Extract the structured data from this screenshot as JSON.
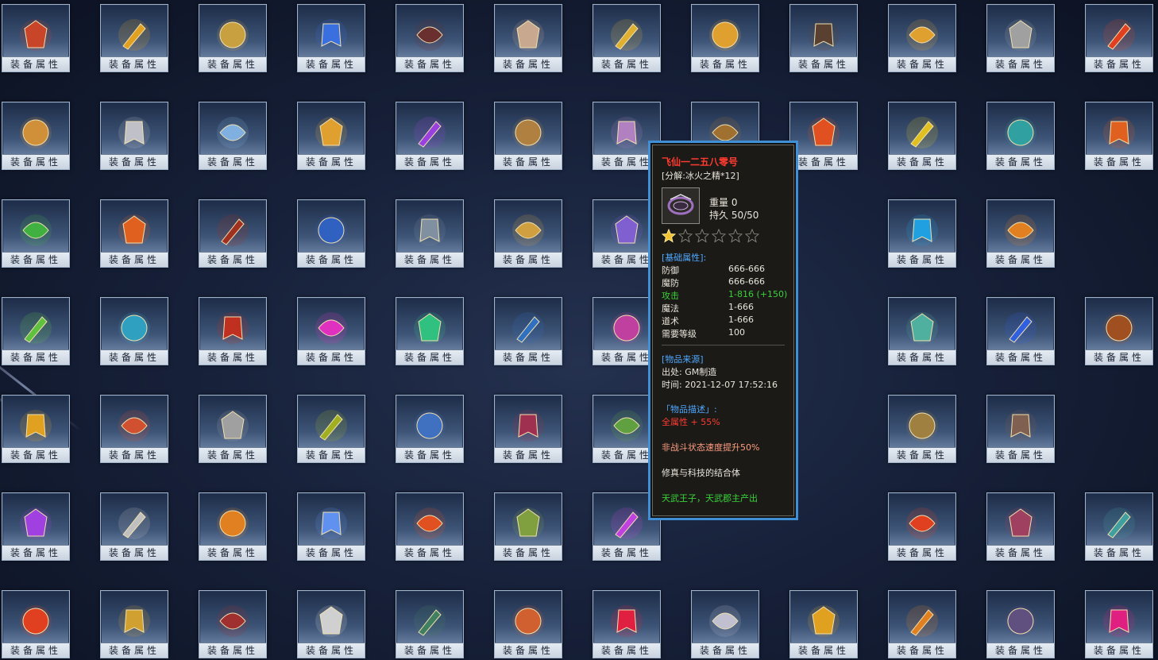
{
  "slot_label": "装备属性",
  "items": [
    {
      "icon": "demon-portrait-icon",
      "color": "#c8452a"
    },
    {
      "icon": "golden-sigil-icon",
      "color": "#e0a020"
    },
    {
      "icon": "golden-warrior-icon",
      "color": "#c9a040"
    },
    {
      "icon": "blue-scroll-icon",
      "color": "#3a6fe0"
    },
    {
      "icon": "dark-gauntlet-icon",
      "color": "#6a3030"
    },
    {
      "icon": "skull-icon",
      "color": "#c9a890"
    },
    {
      "icon": "golden-helmet-icon",
      "color": "#e0b030"
    },
    {
      "icon": "golden-claw-icon",
      "color": "#e0a030"
    },
    {
      "icon": "bracer-icon",
      "color": "#5a4030"
    },
    {
      "icon": "golden-chain-icon",
      "color": "#e0a030"
    },
    {
      "icon": "silver-ring-icon",
      "color": "#a0a0a0"
    },
    {
      "icon": "fire-sword-icon",
      "color": "#e04020"
    },
    {
      "icon": "golden-warrior-icon",
      "color": "#d0903a"
    },
    {
      "icon": "silver-bracelet-icon",
      "color": "#c0c0c8"
    },
    {
      "icon": "ice-bow-icon",
      "color": "#7fb0e0"
    },
    {
      "icon": "golden-warrior-icon",
      "color": "#e0a030"
    },
    {
      "icon": "purple-scroll-icon",
      "color": "#9a40e0"
    },
    {
      "icon": "rune-stone-icon",
      "color": "#b08040"
    },
    {
      "icon": "dark-necklace-icon",
      "color": "#b080c0"
    },
    {
      "icon": "horned-helmet-icon",
      "color": "#a07030"
    },
    {
      "icon": "flame-dagger-icon",
      "color": "#e05020"
    },
    {
      "icon": "yellow-scroll-icon",
      "color": "#e0c020"
    },
    {
      "icon": "jade-ring-icon",
      "color": "#30a0a0"
    },
    {
      "icon": "phoenix-feather-icon",
      "color": "#e06020"
    },
    {
      "icon": "gourd-icon",
      "color": "#40b040"
    },
    {
      "icon": "orange-scroll-icon",
      "color": "#e06020"
    },
    {
      "icon": "red-boots-icon",
      "color": "#a03020"
    },
    {
      "icon": "dragon-armor-icon",
      "color": "#3060c0"
    },
    {
      "icon": "dragon-palace-icon",
      "color": "#8090a0"
    },
    {
      "icon": "golden-egg-icon",
      "color": "#d0a040"
    },
    {
      "icon": "purple-wings-icon",
      "color": "#8060d0"
    },
    {
      "icon": "red-cube-icon",
      "color": "#d04020"
    },
    {
      "icon": "blue-sword-icon",
      "color": "#3080e0"
    },
    {
      "icon": "cyan-scroll-icon",
      "color": "#20a0e0"
    },
    {
      "icon": "golden-sword-icon",
      "color": "#e08020"
    },
    {
      "icon": "none",
      "color": "#000000"
    },
    {
      "icon": "jade-treasure-icon",
      "color": "#60c040"
    },
    {
      "icon": "blue-wings-icon",
      "color": "#30a0c0"
    },
    {
      "icon": "fire-mask-icon",
      "color": "#c03020"
    },
    {
      "icon": "pink-scroll-icon",
      "color": "#e030c0"
    },
    {
      "icon": "jade-halo-icon",
      "color": "#30c080"
    },
    {
      "icon": "earth-orb-icon",
      "color": "#3070c0"
    },
    {
      "icon": "crystal-ball-icon",
      "color": "#c040a0"
    },
    {
      "icon": "none",
      "color": "#000000"
    },
    {
      "icon": "fire-crown-icon",
      "color": "#e06020"
    },
    {
      "icon": "jade-staff-icon",
      "color": "#50b0a0"
    },
    {
      "icon": "blue-shield-icon",
      "color": "#3060e0"
    },
    {
      "icon": "prayer-beads-icon",
      "color": "#a05020"
    },
    {
      "icon": "golden-medallion-icon",
      "color": "#e0a020"
    },
    {
      "icon": "fire-gauntlet-icon",
      "color": "#d05030"
    },
    {
      "icon": "silver-claw-icon",
      "color": "#a0a0a0"
    },
    {
      "icon": "dragon-orb-icon",
      "color": "#a0b020"
    },
    {
      "icon": "blue-mask-icon",
      "color": "#4070c0"
    },
    {
      "icon": "spellbook-icon",
      "color": "#a03050"
    },
    {
      "icon": "leaf-ring-icon",
      "color": "#60a040"
    },
    {
      "icon": "red-dagger-icon",
      "color": "#c02030"
    },
    {
      "icon": "red-scroll-icon",
      "color": "#e02020"
    },
    {
      "icon": "dark-ring-icon",
      "color": "#a08040"
    },
    {
      "icon": "dark-blade-icon",
      "color": "#806050"
    },
    {
      "icon": "none",
      "color": "#000000"
    },
    {
      "icon": "purple-spear-icon",
      "color": "#a040e0"
    },
    {
      "icon": "bone-claw-icon",
      "color": "#c0c0c0"
    },
    {
      "icon": "fire-wand-icon",
      "color": "#e08020"
    },
    {
      "icon": "blue-lotus-icon",
      "color": "#6090f0"
    },
    {
      "icon": "fire-wing-icon",
      "color": "#e05020"
    },
    {
      "icon": "jade-beast-icon",
      "color": "#80a040"
    },
    {
      "icon": "magic-circle-icon",
      "color": "#c040e0"
    },
    {
      "icon": "none",
      "color": "#000000"
    },
    {
      "icon": "ruby-ring-icon",
      "color": "#d0a030"
    },
    {
      "icon": "fire-armor-icon",
      "color": "#e04020"
    },
    {
      "icon": "demon-claw-icon",
      "color": "#a04060"
    },
    {
      "icon": "crystal-armor-icon",
      "color": "#40a0a0"
    },
    {
      "icon": "fire-orb-icon",
      "color": "#e04020"
    },
    {
      "icon": "black-gold-icon",
      "color": "#d0a030"
    },
    {
      "icon": "red-tome-icon",
      "color": "#a03030"
    },
    {
      "icon": "skull-icon",
      "color": "#d0d0d0"
    },
    {
      "icon": "jade-tablet-icon",
      "color": "#408060"
    },
    {
      "icon": "scroll-map-icon",
      "color": "#d06030"
    },
    {
      "icon": "red-scroll-icon",
      "color": "#e02040"
    },
    {
      "icon": "angel-portrait-icon",
      "color": "#c0c0d0"
    },
    {
      "icon": "golden-helm-icon",
      "color": "#e0a020"
    },
    {
      "icon": "fire-bird-icon",
      "color": "#e08020"
    },
    {
      "icon": "dark-gauntlet-icon",
      "color": "#605080"
    },
    {
      "icon": "pink-scroll-icon",
      "color": "#e02080"
    }
  ],
  "tooltip": {
    "name": "飞仙一二五八零号",
    "decompose": "[分解:冰火之精*12]",
    "weight_label": "重量 0",
    "durability_label": "持久 50/50",
    "stars_filled": 1,
    "stars_total": 6,
    "base_attr_title": "[基础属性]:",
    "stats": [
      {
        "name": "防御",
        "value": "666-666",
        "color": "#e8e4da"
      },
      {
        "name": "魔防",
        "value": "666-666",
        "color": "#e8e4da"
      },
      {
        "name": "攻击",
        "value": "1-816 (+150)",
        "color": "#3ad23a"
      },
      {
        "name": "魔法",
        "value": "1-666",
        "color": "#e8e4da"
      },
      {
        "name": "道术",
        "value": "1-666",
        "color": "#e8e4da"
      },
      {
        "name": "需要等级",
        "value": "100",
        "color": "#e8e4da"
      }
    ],
    "source_title": "[物品来源]",
    "source_origin": "出处: GM制造",
    "source_time": "时间: 2021-12-07 17:52:16",
    "desc_title": "「物品描述」:",
    "desc_all_attr": "全属性 + 55%",
    "desc_speed": "非战斗状态速度提升50%",
    "desc_fusion": "修真与科技的结合体",
    "desc_producer": "天武王子，天武郡主产出"
  }
}
